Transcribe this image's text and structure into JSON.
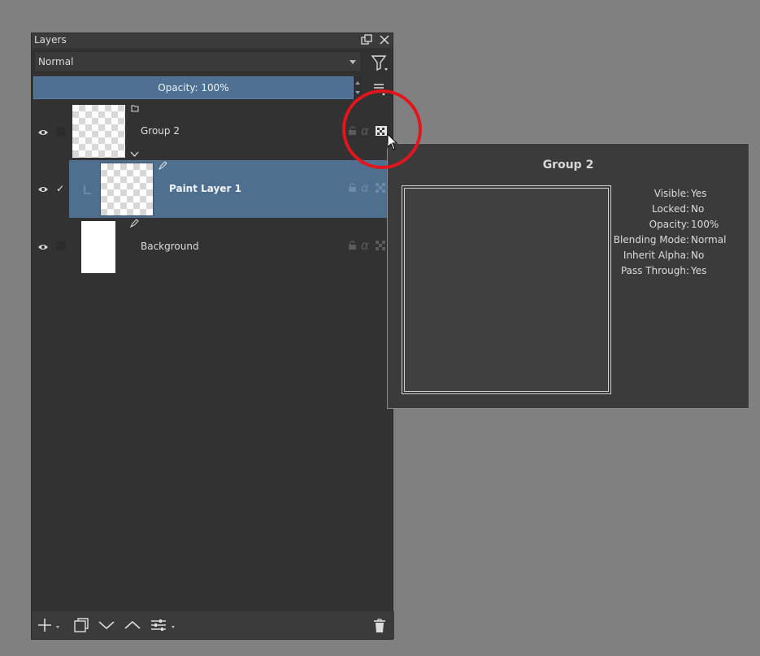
{
  "panel": {
    "title": "Layers",
    "blend_mode": "Normal",
    "opacity_label": "Opacity:  100%"
  },
  "layers": [
    {
      "name": "Group 2",
      "selected": false,
      "visible": true,
      "type": "group"
    },
    {
      "name": "Paint Layer 1",
      "selected": true,
      "visible": true,
      "type": "paint"
    },
    {
      "name": "Background",
      "selected": false,
      "visible": true,
      "type": "paint"
    }
  ],
  "tooltip": {
    "title": "Group 2",
    "rows": [
      {
        "key": "Visible:",
        "value": "Yes"
      },
      {
        "key": "Locked:",
        "value": "No"
      },
      {
        "key": "Opacity:",
        "value": "100%"
      },
      {
        "key": "Blending Mode:",
        "value": "Normal"
      },
      {
        "key": "Inherit Alpha:",
        "value": "No"
      },
      {
        "key": "Pass Through:",
        "value": "Yes"
      }
    ]
  },
  "icons": {
    "float": "float-window-icon",
    "close": "close-icon",
    "filter": "filter-icon",
    "menu": "hamburger-menu-icon",
    "eye": "eye-icon",
    "add": "plus-icon",
    "duplicate": "duplicate-icon",
    "move_down": "chevron-down-icon",
    "move_up": "chevron-up-icon",
    "properties": "sliders-icon",
    "delete": "trash-icon",
    "lock": "lock-icon",
    "alpha": "alpha-lock-icon",
    "passthrough": "pass-through-icon"
  },
  "colors": {
    "selection": "#4f6f8f",
    "highlight_circle": "#e0161c"
  }
}
